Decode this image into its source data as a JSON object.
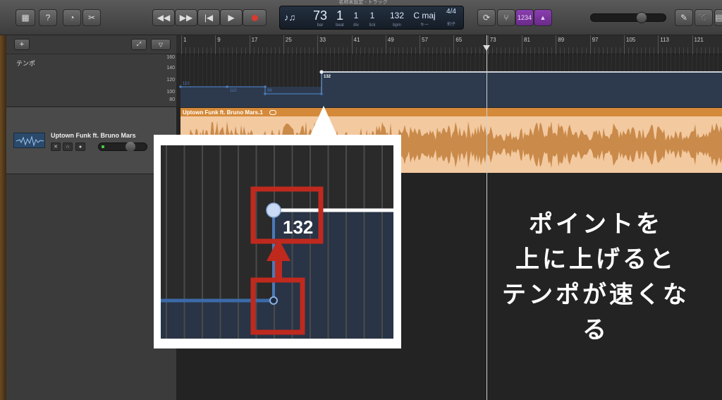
{
  "window": {
    "title": "名称未設定 - トラック"
  },
  "toolbar": {
    "lcd": {
      "bar": "73",
      "beat": "1",
      "div": "1",
      "tick": "1",
      "bpm": "132",
      "key": "C maj",
      "time_sig_top": "4",
      "time_sig_bottom": "4",
      "bar_caption": "bar",
      "beat_caption": "beat",
      "div_caption": "div",
      "tick_caption": "tick",
      "bpm_caption": "bpm",
      "key_caption": "キー",
      "sig_caption": "拍子"
    },
    "count_in_label": "1234",
    "master_volume": 0.7
  },
  "header": {
    "add_label": "+"
  },
  "tempo_track": {
    "label": "テンポ",
    "scale": [
      "160",
      "140",
      "120",
      "100",
      "80"
    ],
    "point_labels": [
      "110",
      "110",
      "96",
      "132"
    ]
  },
  "audio_track": {
    "name": "Uptown Funk ft. Bruno Mars",
    "region_name": "Uptown Funk ft. Bruno Mars.1"
  },
  "ruler": {
    "bars": [
      "1",
      "9",
      "17",
      "25",
      "33",
      "41",
      "49",
      "57",
      "65",
      "73",
      "81",
      "89",
      "97",
      "105",
      "113",
      "121"
    ]
  },
  "callout": {
    "value": "132"
  },
  "caption": {
    "lines": [
      "ポイントを",
      "上に上げると",
      "テンポが速くなる"
    ]
  },
  "colors": {
    "tempo_line": "#4a7ab8",
    "region_header": "#d58a3a",
    "region_body": "#f3c9a0",
    "highlight": "#c0291e",
    "count_in": "#8a3fb0"
  }
}
